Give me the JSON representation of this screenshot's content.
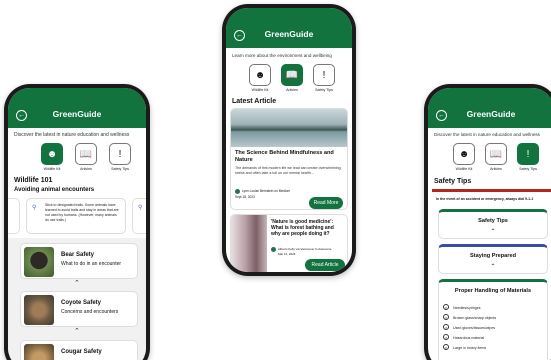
{
  "app": {
    "title": "GreenGuide"
  },
  "tabs": [
    {
      "label": "Wildlife Kit",
      "icon": "bear-icon"
    },
    {
      "label": "Articles",
      "icon": "book-icon"
    },
    {
      "label": "Safety Tips",
      "icon": "alert-icon"
    }
  ],
  "left": {
    "intro": "Discover the latest in nature education and wellness",
    "heading": "Wildlife 101",
    "subheading": "Avoiding animal encounters",
    "tip_text": "Stick to designated trails. Some animals have learned to avoid trails and stay in areas that are not used by humans. (However, many animals do use trails.)",
    "items": [
      {
        "title": "Bear Safety",
        "subtitle": "What to do in an encounter"
      },
      {
        "title": "Coyote Safety",
        "subtitle": "Concerns and encounters"
      },
      {
        "title": "Cougar Safety",
        "subtitle": ""
      }
    ]
  },
  "center": {
    "intro": "Learn more about the environment and wellbeing",
    "section": "Latest Article",
    "article1": {
      "title": "The Science Behind Mindfulness and Nature",
      "body": "The demands of this modern life we lead can create overwhelming stress and often take a toll on our mental health...",
      "author": "Lynn Louise Bernstein on Medium",
      "date": "Sept 18, 2023",
      "button": "Read More"
    },
    "article2": {
      "title": "'Nature is good medicine': What is forest bathing and why are people doing it?",
      "author": "Alberto Kelly via Vancouver Is Awesome",
      "date": "Mar 11, 2024",
      "button": "Read Article"
    }
  },
  "right": {
    "intro": "Discover the latest in nature education and wellness",
    "heading": "Safety Tips",
    "alert": "In the event of an accident or emergency, always dial 9-1-1",
    "sections": [
      "Safety Tips",
      "Staying Prepared",
      "Proper Handling of Materials"
    ],
    "materials": [
      "Needles/syringes",
      "Broken glass/sharp objects",
      "Used gloves/tissues/wipes",
      "Hazardous material",
      "Large in heavy items"
    ]
  }
}
